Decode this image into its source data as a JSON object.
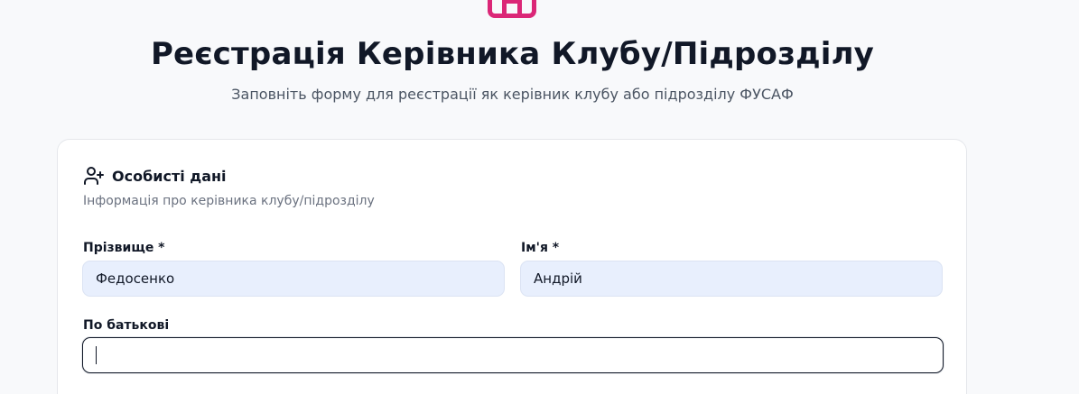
{
  "header": {
    "title": "Реєстрація Керівника Клубу/Підрозділу",
    "subtitle": "Заповніть форму для реєстрації як керівник клубу або підрозділу ФУСАФ",
    "accent_color": "#db2777"
  },
  "section": {
    "icon": "user-plus-icon",
    "title": "Особисті дані",
    "description": "Інформація про керівника клубу/підрозділу"
  },
  "fields": {
    "last_name": {
      "label": "Прізвище *",
      "value": "Федосенко"
    },
    "first_name": {
      "label": "Ім'я *",
      "value": "Андрій"
    },
    "patronymic": {
      "label": "По батькові",
      "value": ""
    }
  },
  "colors": {
    "filled_input_bg": "#e8effd",
    "focus_border": "#111827"
  }
}
